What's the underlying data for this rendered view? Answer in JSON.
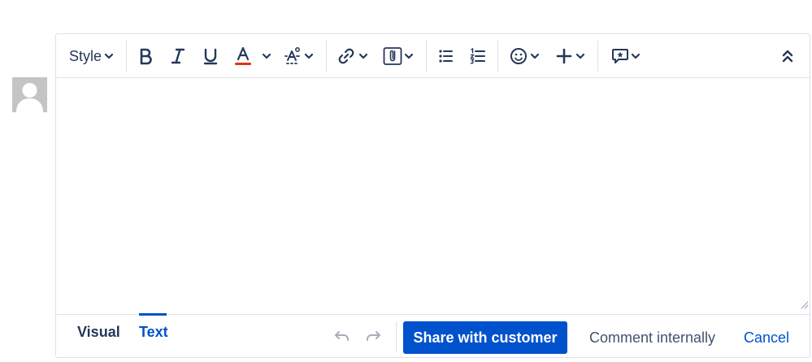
{
  "toolbar": {
    "style_label": "Style",
    "icons": [
      "bold-icon",
      "italic-icon",
      "underline-icon",
      "text-color-icon",
      "text-effects-icon",
      "link-icon",
      "attachment-icon",
      "bullet-list-icon",
      "numbered-list-icon",
      "emoji-icon",
      "insert-icon",
      "canned-response-icon",
      "collapse-toolbar-icon"
    ],
    "text_color_accent": "#DE350B"
  },
  "modes": {
    "visual": "Visual",
    "text": "Text",
    "active": "text"
  },
  "actions": {
    "share": "Share with customer",
    "internal": "Comment internally",
    "cancel": "Cancel"
  },
  "colors": {
    "primary": "#0052CC",
    "text": "#172B4D",
    "border": "#DFE1E6"
  }
}
